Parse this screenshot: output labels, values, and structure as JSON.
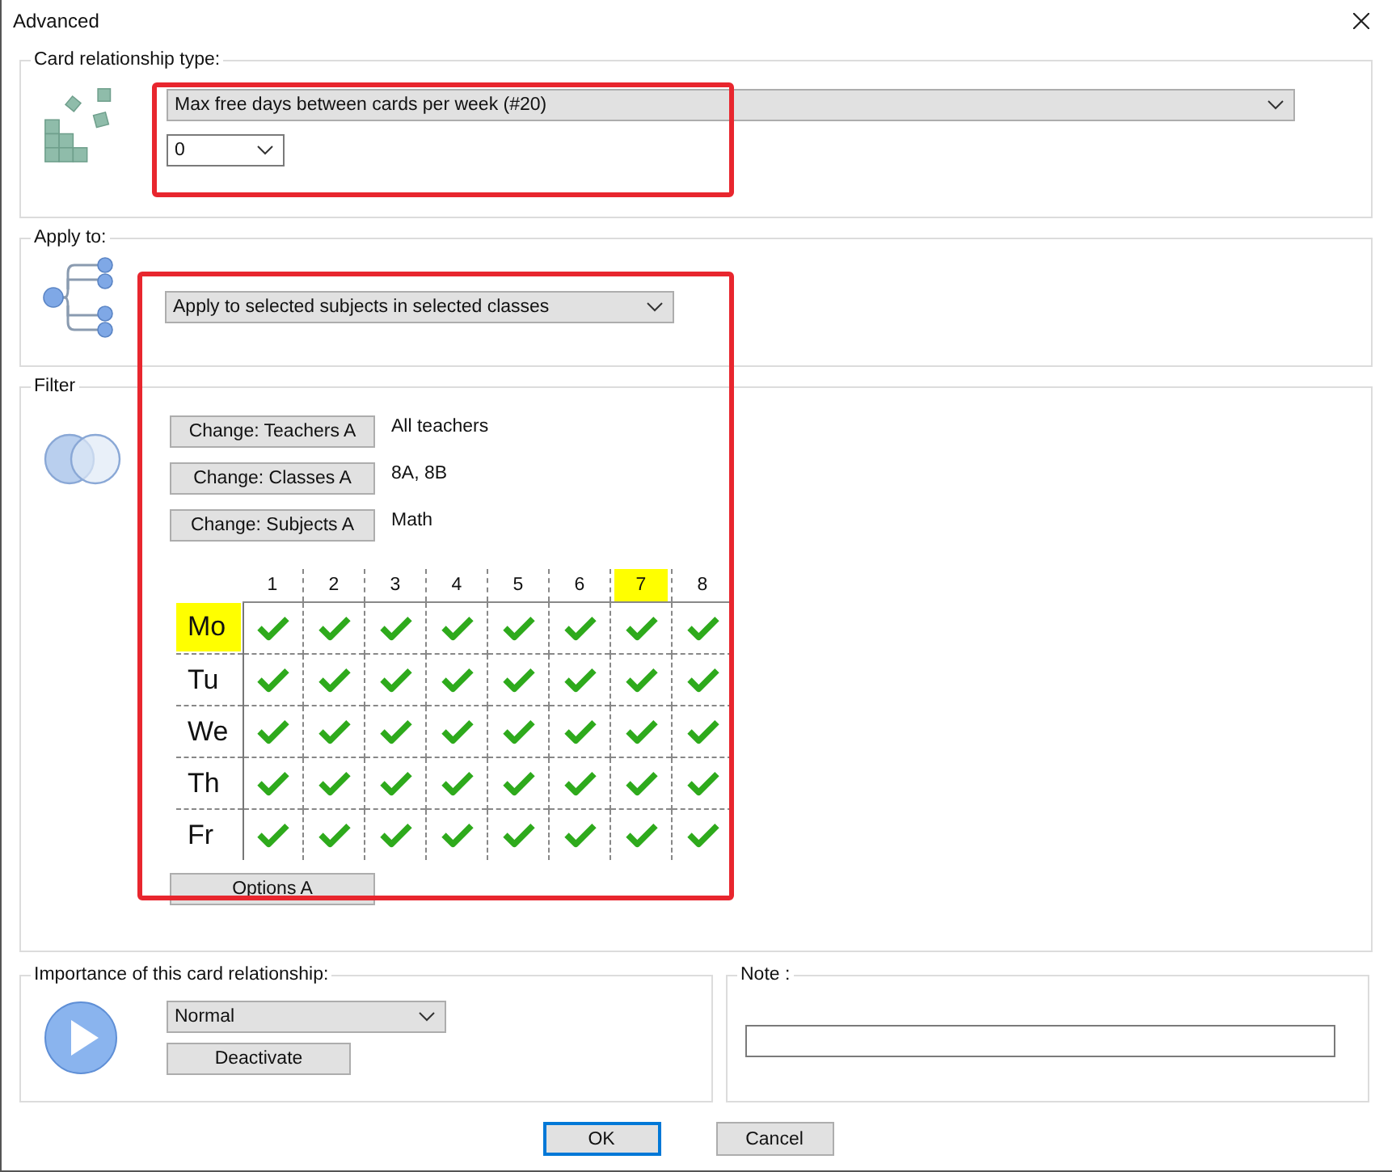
{
  "window": {
    "title": "Advanced"
  },
  "relationship_type": {
    "label": "Card relationship type:",
    "type": "Max free days between cards per week (#20)",
    "value": "0"
  },
  "apply_to": {
    "label": "Apply to:",
    "scope": "Apply to selected subjects in selected classes"
  },
  "filter": {
    "label": "Filter",
    "rows": [
      {
        "button": "Change: Teachers A",
        "value": "All teachers"
      },
      {
        "button": "Change: Classes A",
        "value": "8A, 8B"
      },
      {
        "button": "Change: Subjects A",
        "value": "Math"
      }
    ],
    "periods": [
      {
        "label": "1",
        "selected": false
      },
      {
        "label": "2",
        "selected": false
      },
      {
        "label": "3",
        "selected": false
      },
      {
        "label": "4",
        "selected": false
      },
      {
        "label": "5",
        "selected": false
      },
      {
        "label": "6",
        "selected": false
      },
      {
        "label": "7",
        "selected": true
      },
      {
        "label": "8",
        "selected": false
      }
    ],
    "days": [
      {
        "label": "Mo",
        "selected": true,
        "slots": [
          true,
          true,
          true,
          true,
          true,
          true,
          true,
          true
        ]
      },
      {
        "label": "Tu",
        "selected": false,
        "slots": [
          true,
          true,
          true,
          true,
          true,
          true,
          true,
          true
        ]
      },
      {
        "label": "We",
        "selected": false,
        "slots": [
          true,
          true,
          true,
          true,
          true,
          true,
          true,
          true
        ]
      },
      {
        "label": "Th",
        "selected": false,
        "slots": [
          true,
          true,
          true,
          true,
          true,
          true,
          true,
          true
        ]
      },
      {
        "label": "Fr",
        "selected": false,
        "slots": [
          true,
          true,
          true,
          true,
          true,
          true,
          true,
          true
        ]
      }
    ],
    "options_button": "Options A"
  },
  "importance": {
    "label": "Importance of this card relationship:",
    "level": "Normal",
    "deactivate_button": "Deactivate"
  },
  "note": {
    "label": "Note :"
  },
  "buttons": [
    {
      "label": "OK",
      "default": true
    },
    {
      "label": "Cancel",
      "default": false
    }
  ]
}
